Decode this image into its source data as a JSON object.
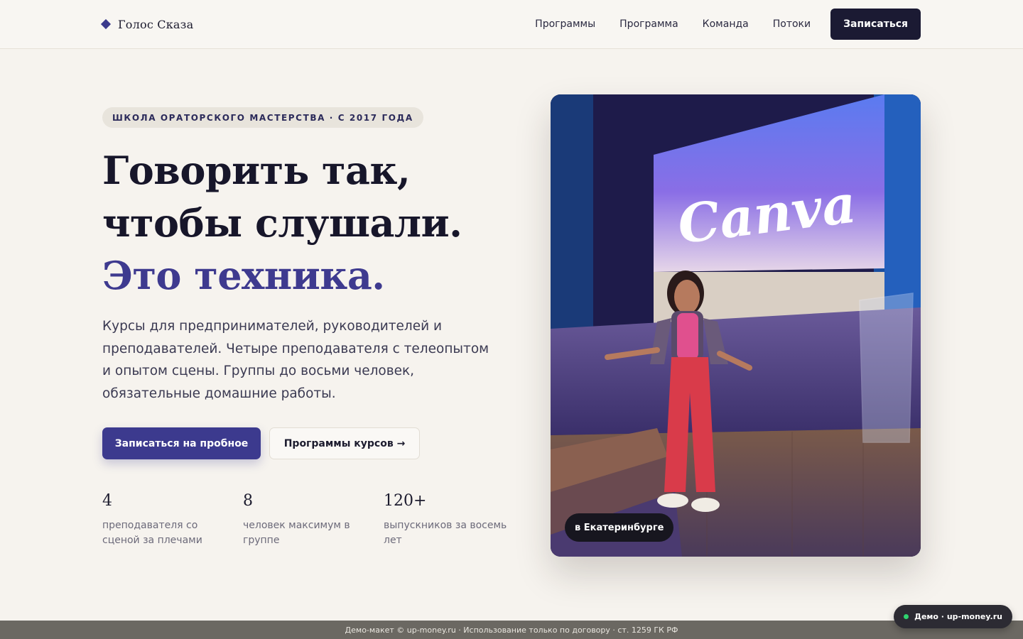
{
  "brand": {
    "name": "Голос Сказа",
    "accent_color": "#3c3a8e"
  },
  "nav": {
    "links": [
      "Программы",
      "Программа",
      "Команда",
      "Потоки"
    ],
    "cta_label": "Записаться"
  },
  "hero": {
    "badge": "ШКОЛА ОРАТОРСКОГО МАСТЕРСТВА · С 2017 ГОДА",
    "headline_line1": "Говорить так,",
    "headline_line2": "чтобы слушали.",
    "headline_accent": "Это техника.",
    "lead": "Курсы для предпринимателей, руководителей и преподавателей. Четыре преподавателя с телеопытом и опытом сцены. Группы до восьми человек, обязательные домашние работы.",
    "primary_button": "Записаться на пробное",
    "secondary_button": "Программы курсов →",
    "stats": [
      {
        "value": "4",
        "label": "преподавателя со сценой за плечами"
      },
      {
        "value": "8",
        "label": "человек максимум в группе"
      },
      {
        "value": "120+",
        "label": "выпускников за восемь лет"
      }
    ],
    "photo_caption": "в Екатеринбурге",
    "screen_text": "Canva"
  },
  "footer": {
    "notice": "Демо-макет © up-money.ru · Использование только по договору · ст. 1259 ГК РФ",
    "demo_label": "Демо · up-money.ru"
  }
}
